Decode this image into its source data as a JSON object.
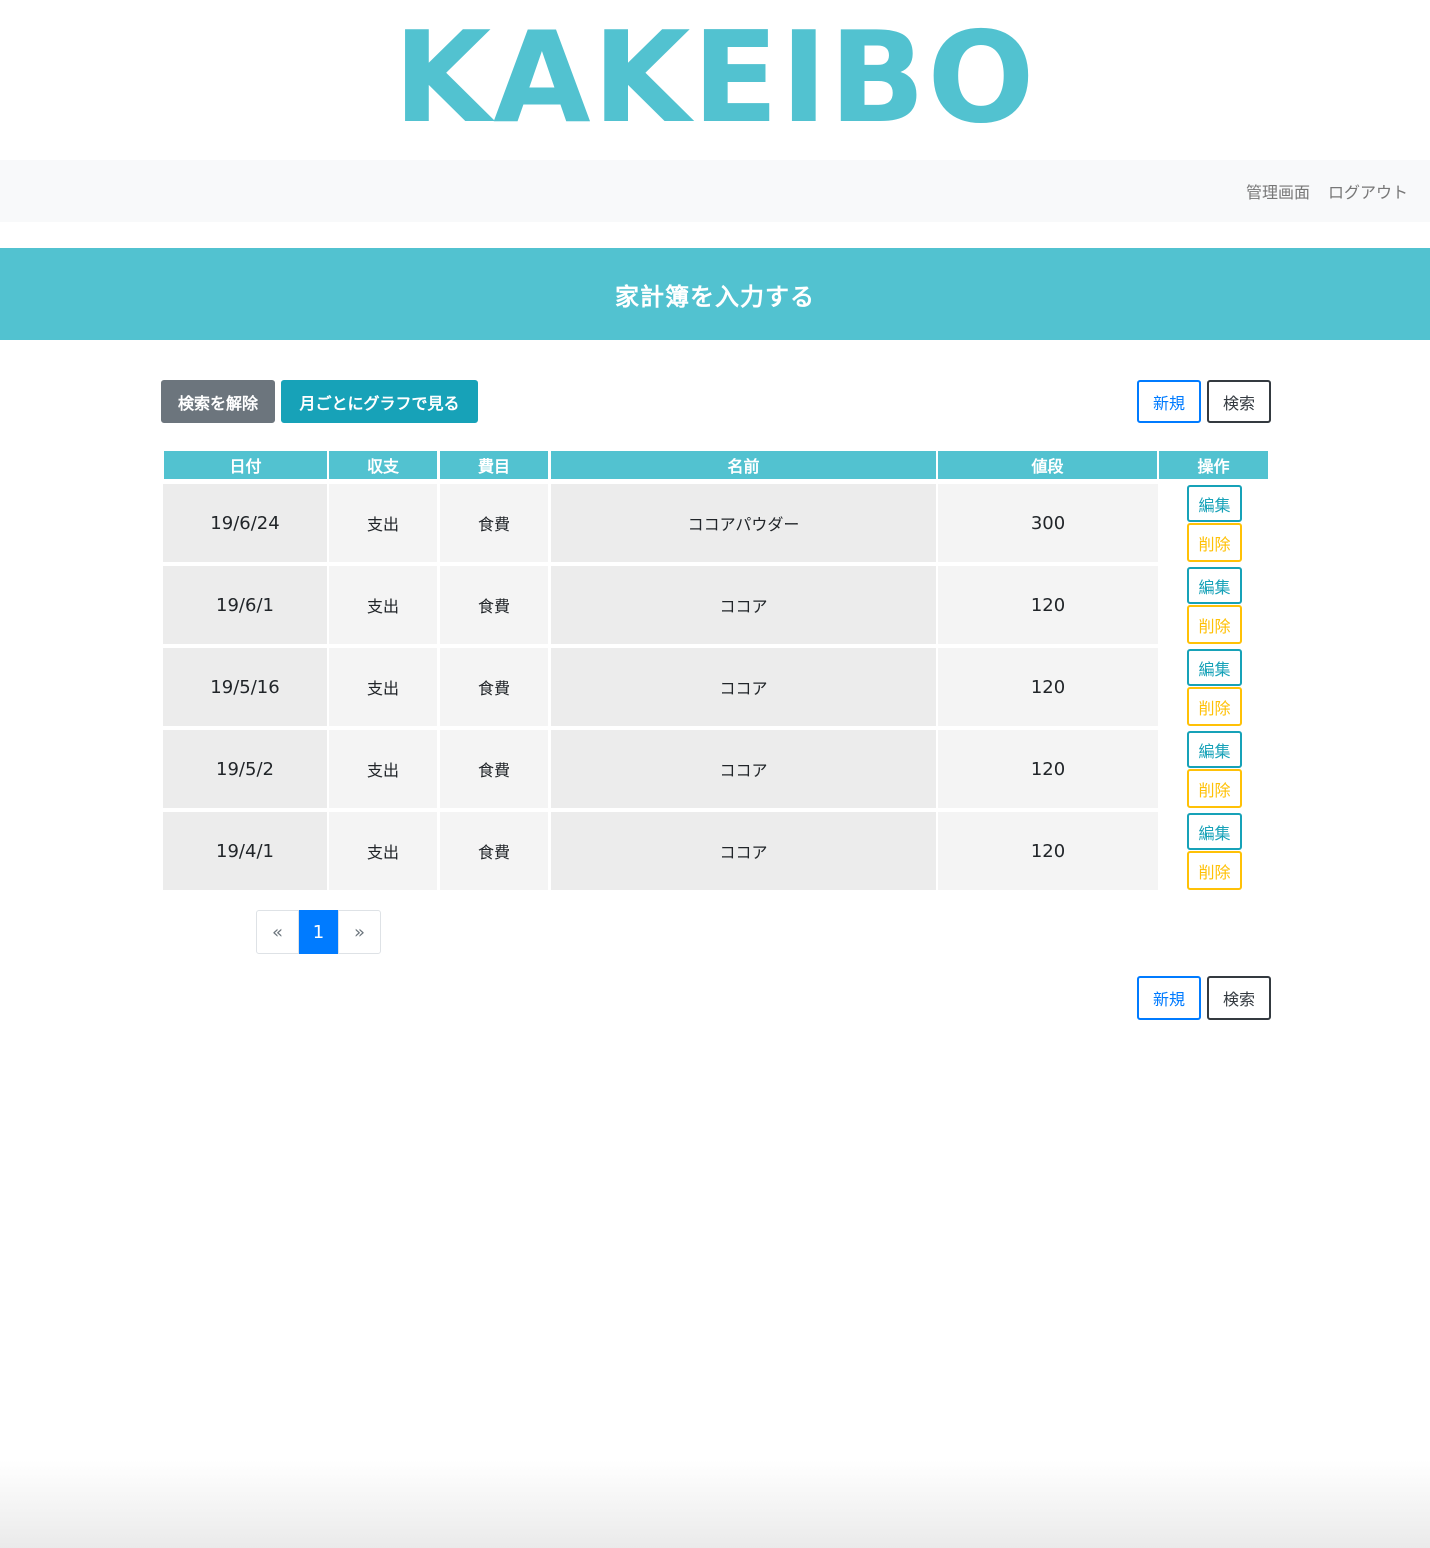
{
  "header": {
    "logo": "KAKEIBO"
  },
  "nav": {
    "admin_label": "管理画面",
    "logout_label": "ログアウト"
  },
  "banner": {
    "title": "家計簿を入力する"
  },
  "toolbar": {
    "clear_search_label": "検索を解除",
    "monthly_graph_label": "月ごとにグラフで見る",
    "new_label": "新規",
    "search_label": "検索"
  },
  "table": {
    "columns": [
      "日付",
      "収支",
      "費目",
      "名前",
      "値段",
      "操作"
    ],
    "rows": [
      {
        "date": "19/6/24",
        "type": "支出",
        "category": "食費",
        "name": "ココアパウダー",
        "price": "300"
      },
      {
        "date": "19/6/1",
        "type": "支出",
        "category": "食費",
        "name": "ココア",
        "price": "120"
      },
      {
        "date": "19/5/16",
        "type": "支出",
        "category": "食費",
        "name": "ココア",
        "price": "120"
      },
      {
        "date": "19/5/2",
        "type": "支出",
        "category": "食費",
        "name": "ココア",
        "price": "120"
      },
      {
        "date": "19/4/1",
        "type": "支出",
        "category": "食費",
        "name": "ココア",
        "price": "120"
      }
    ],
    "edit_label": "編集",
    "delete_label": "削除"
  },
  "pagination": {
    "prev": "«",
    "current": "1",
    "next": "»"
  },
  "colors": {
    "brand": "#52c2d0",
    "primary": "#007bff",
    "info": "#17a2b8",
    "warning": "#ffc107",
    "secondary": "#6c757d"
  }
}
